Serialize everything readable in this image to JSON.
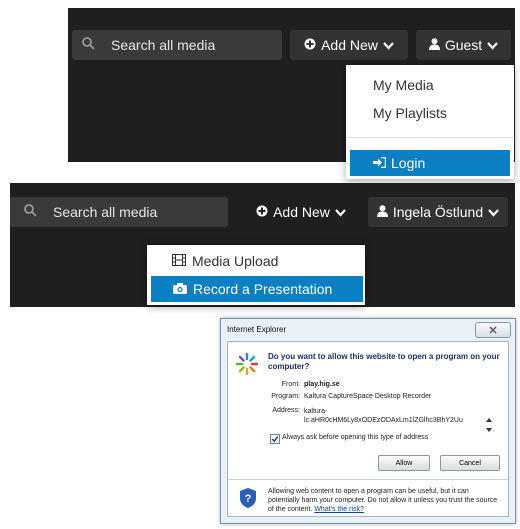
{
  "panel1": {
    "search_placeholder": "Search all media",
    "add_new_label": "Add New",
    "user_label": "Guest",
    "menu": {
      "my_media": "My Media",
      "my_playlists": "My Playlists",
      "login": "Login"
    }
  },
  "panel2": {
    "search_placeholder": "Search all media",
    "add_new_label": "Add New",
    "user_label": "Ingela Östlund",
    "menu": {
      "media_upload": "Media Upload",
      "record_presentation": "Record a Presentation"
    }
  },
  "dialog": {
    "title": "Internet Explorer",
    "question": "Do you want to allow this website to open a program on your computer?",
    "from_label": "From:",
    "from_value": "play.hig.se",
    "program_label": "Program:",
    "program_value": "Kaltura CaptureSpace Desktop Recorder",
    "address_label": "Address:",
    "address_value_1": "kaltura-",
    "address_value_2": "lc:aHR0cHM6Ly8xODEzODAxLm1lZGlhc3BhY2Uu",
    "checkbox_label": "Always ask before opening this type of address",
    "allow_label": "Allow",
    "cancel_label": "Cancel",
    "warning_text": "Allowing web content to open a program can be useful, but it can potentially harm your computer. Do not allow it unless you trust the source of the content.",
    "warning_link": "What's the risk?"
  },
  "colors": {
    "nav_bg": "#1f1f1f",
    "accent": "#0b7fc4",
    "link": "#0645ad"
  },
  "icons": [
    "search-icon",
    "plus-circle-icon",
    "chevron-down-icon",
    "user-icon",
    "login-icon",
    "film-icon",
    "camera-icon",
    "close-icon",
    "shield-icon",
    "scroll-up-icon",
    "scroll-down-icon"
  ]
}
